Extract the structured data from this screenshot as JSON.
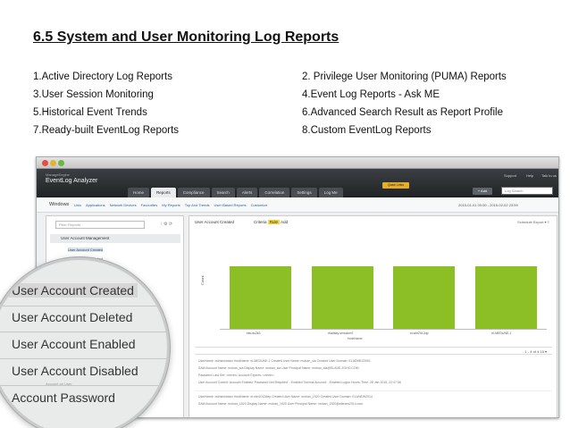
{
  "slide": {
    "title": "6.5 System and User Monitoring Log Reports",
    "list_left": [
      "1.Active Directory Log Reports",
      "3.User Session Monitoring",
      "5.Historical Event Trends",
      "7.Ready-built EventLog Reports"
    ],
    "list_right": [
      "2. Privilege User Monitoring (PUMA) Reports",
      "4.Event Log Reports - Ask ME",
      "6.Advanced Search Result as Report Profile",
      "8.Custom EventLog Reports"
    ]
  },
  "app": {
    "brand_small": "ManageEngine",
    "brand": "EventLog Analyzer",
    "tabs": [
      "Home",
      "Reports",
      "Compliance",
      "Search",
      "Alerts",
      "Correlation",
      "Settings",
      "Log Me"
    ],
    "active_tab": "Reports",
    "header_links": [
      "Support",
      "Help",
      "Talk to us"
    ],
    "quick_link": "Quick Links",
    "add_button": "+ Add",
    "search_placeholder": "Log Search",
    "subnav_os": "Windows",
    "subnav_links": [
      "Unix",
      "Applications",
      "Network Devices",
      "Favourites",
      "My Reports",
      "Top And Trends",
      "User Based Reports",
      "Customize"
    ],
    "date_range": "2015-01-01 00:00 - 2015-02-02 23:59",
    "sidebar": {
      "search_placeholder": "Filter Reports",
      "tools": "⁝ ⚙ ⟳",
      "group": "User Account Management",
      "items": [
        "User Account Created",
        "User Account Deleted"
      ]
    },
    "report": {
      "title": "User Account Created",
      "criteria_label": "Criteria",
      "criteria_value": "Rule",
      "criteria_more": "Add",
      "toolbar": "Schedule   Export ▾   ≡"
    },
    "pager": "1 - 4 of 4   15 ▾",
    "records": [
      {
        "line1": "UserName: administrator   HostName: el-MEDUNE-1   Created User Name: mohan_sia   Created User Domain: ELADMEZ0901",
        "line2": "SAM Account Name: mohan_sia   Display Name: mohan_sia   User Principal Name: mohan_sia@ELADE.ZOHO.COM",
        "line3": "Password Last Set: <never>   Account Expires: <never>",
        "line4": "User Account Control: Account Enabled 'Password Not Required' - Enabled 'Normal Account' - Enabled   Logon Hours:   Time: 28 Jan 2015, 22:47:56"
      },
      {
        "line1": "UserName: administrator   HostName: el-win2012dep   Created User Name: mohan_1520   Created User Domain: ELANEW2014",
        "line2": "SAM Account Name: mohan_1520   Display Name: mohan_1520   User Principal Name: mohan_1520@elanew2014.com",
        "line3": "",
        "line4": ""
      }
    ]
  },
  "chart_data": {
    "type": "bar",
    "categories": [
      "elw-dc2k3",
      "eladsky-srvsdom7",
      "el-win2012dp",
      "el-MEDUNE-1"
    ],
    "values": [
      1,
      1,
      1,
      1
    ],
    "xlabel": "HostName",
    "ylabel": "Count",
    "bar_color": "#8cbf26"
  },
  "magnifier": {
    "items": [
      "User Account Created",
      "User Account Deleted",
      "User Account Enabled",
      "User Account Disabled",
      "Account Password"
    ],
    "blur_text": "Account on User"
  },
  "colors": {
    "accent_bar": "#8cbf26",
    "quick_link": "#e5ad2a",
    "criteria_badge": "#f3d43a"
  }
}
